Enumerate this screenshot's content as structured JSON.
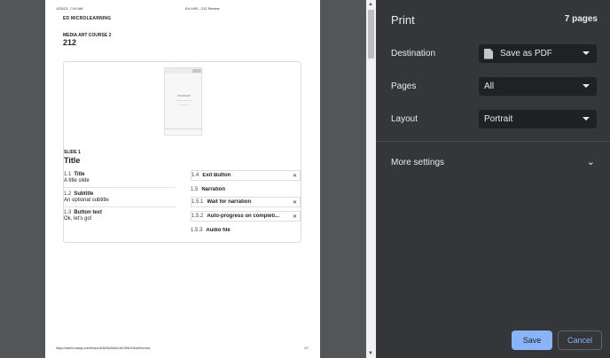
{
  "preview": {
    "header_date": "1/25/23, 7:19 AM",
    "header_title": "Ed LMS - 212 Review",
    "brand": "ED MICROLEARNING",
    "course_name": "MEDIA ART COURSE 2",
    "course_id": "212",
    "slide_label": "SLIDE 1",
    "slide_title": "Title",
    "fields": [
      {
        "num": "1.1",
        "name": "Title",
        "value": "A title slide"
      },
      {
        "num": "1.2",
        "name": "Subtitle",
        "value": "An optional subtitle"
      },
      {
        "num": "1.3",
        "name": "Button text",
        "value": "Ok, let's go!"
      }
    ],
    "options": [
      {
        "num": "1.4",
        "name": "Exit Button",
        "x": "✕"
      },
      {
        "num": "1.5",
        "name": "Narration",
        "x": ""
      },
      {
        "num": "1.5.1",
        "name": "Wait for narration",
        "x": "✕"
      },
      {
        "num": "1.5.2",
        "name": "Auto-progress on completi...",
        "x": "✕"
      },
      {
        "num": "1.5.3",
        "name": "Audio file",
        "x": ""
      }
    ],
    "footer_url": "https://admin.edapp.com/lesson/63b2fa269a14b13f94104da5/review",
    "footer_page": "1/7"
  },
  "print": {
    "title": "Print",
    "page_count": "7 pages",
    "destination_label": "Destination",
    "destination_value": "Save as PDF",
    "pages_label": "Pages",
    "pages_value": "All",
    "layout_label": "Layout",
    "layout_value": "Portrait",
    "more_settings": "More settings",
    "save_label": "Save",
    "cancel_label": "Cancel"
  },
  "colors": {
    "panel_bg": "#35363a",
    "select_bg": "#202124",
    "accent": "#8ab4f8",
    "preview_bg": "#525659"
  },
  "icons": [
    "document-icon",
    "chevron-down-icon",
    "close-icon",
    "scroll-up-arrow-icon",
    "scroll-down-arrow-icon"
  ]
}
